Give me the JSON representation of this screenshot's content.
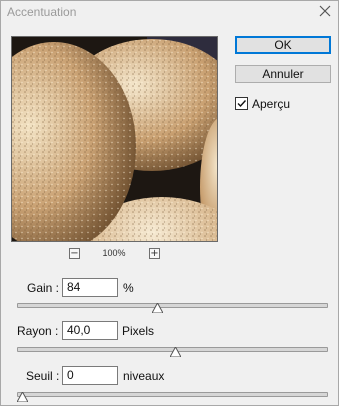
{
  "window": {
    "title": "Accentuation",
    "close_icon": "close-icon"
  },
  "preview": {
    "zoom_out": "−",
    "zoom_in": "+",
    "zoom_level": "100%"
  },
  "buttons": {
    "ok": "OK",
    "cancel": "Annuler"
  },
  "preview_toggle": {
    "label": "Aperçu",
    "checked": true
  },
  "controls": {
    "gain": {
      "label": "Gain :",
      "value": "84",
      "unit": "%",
      "slider_fraction": 0.45
    },
    "rayon": {
      "label": "Rayon :",
      "value": "40,0",
      "unit": "Pixels",
      "slider_fraction": 0.51
    },
    "seuil": {
      "label": "Seuil :",
      "value": "0",
      "unit": "niveaux",
      "slider_fraction": 0.0
    }
  }
}
